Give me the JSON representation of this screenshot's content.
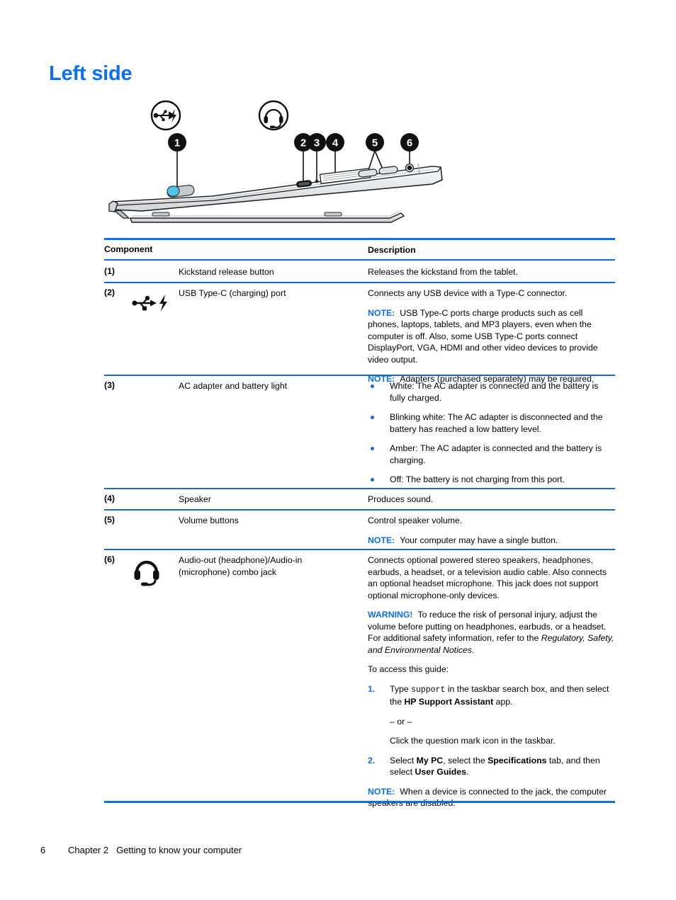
{
  "document": {
    "heading": "Left side",
    "footer": {
      "page_number": "6",
      "chapter": "Chapter 2",
      "chapter_title": "Getting to know your computer"
    },
    "accent_color": "#0a6ff0",
    "rule_color": "#1268d8"
  },
  "figure": {
    "name": "left-side-tablet-illustration",
    "callouts": [
      "1",
      "2",
      "3",
      "4",
      "5",
      "6"
    ],
    "icons": [
      {
        "name": "usb-type-c-charging-icon",
        "label": "USB Type-C charging"
      },
      {
        "name": "headset-icon",
        "label": "Audio-out / Audio-in headset"
      }
    ]
  },
  "table": {
    "headers": {
      "component": "Component",
      "description": "Description"
    },
    "rows": [
      {
        "number": "(1)",
        "icon": "",
        "name": "Kickstand release button",
        "description": "Releases the kickstand from the tablet."
      },
      {
        "number": "(2)",
        "icon": "usb-type-c-charging-icon",
        "name": "USB Type-C (charging) port",
        "desc_intro": "Connects any USB device with a Type-C connector.",
        "note1_label": "NOTE:",
        "note1_text": "USB Type-C ports charge products such as cell phones, laptops, tablets, and MP3 players, even when the computer is off. Also, some USB Type-C ports connect DisplayPort, VGA, HDMI and other video devices to provide video output.",
        "note2_label": "NOTE:",
        "note2_text": "Adapters (purchased separately) may be required."
      },
      {
        "number": "(3)",
        "icon": "",
        "name": "AC adapter and battery light",
        "bullets": [
          "White: The AC adapter is connected and the battery is fully charged.",
          "Blinking white: The AC adapter is disconnected and the battery has reached a low battery level.",
          "Amber: The AC adapter is connected and the battery is charging.",
          "Off: The battery is not charging from this port."
        ]
      },
      {
        "number": "(4)",
        "icon": "",
        "name": "Speaker",
        "description": "Produces sound."
      },
      {
        "number": "(5)",
        "icon": "",
        "name": "Volume buttons",
        "desc_intro": "Control speaker volume.",
        "note1_label": "NOTE:",
        "note1_text": "Your computer may have a single button."
      },
      {
        "number": "(6)",
        "icon": "headset-icon",
        "name": "Audio-out (headphone)/Audio-in (microphone) combo jack",
        "desc_intro": "Connects optional powered stereo speakers, headphones, earbuds, a headset, or a television audio cable. Also connects an optional headset microphone. This jack does not support optional microphone-only devices.",
        "warning_label": "WARNING!",
        "warning_text_a": "To reduce the risk of personal injury, adjust the volume before putting on headphones, earbuds, or a headset. For additional safety information, refer to the ",
        "warning_text_italic": "Regulatory, Safety, and Environmental Notices.",
        "access_intro": "To access this guide:",
        "step1_num": "1.",
        "step1_a": "Type ",
        "step1_mono": "support",
        "step1_b": " in the taskbar search box, and then select the ",
        "step1_bold": "HP Support Assistant",
        "step1_c": " app.",
        "step1_or": "– or –",
        "step1_alt": "Click the question mark icon in the taskbar.",
        "step2_num": "2.",
        "step2_a": "Select ",
        "step2_bold1": "My PC",
        "step2_b": ", select the ",
        "step2_bold2": "Specifications",
        "step2_c": " tab, and then select ",
        "step2_bold3": "User Guides",
        "step2_d": ".",
        "note1_label": "NOTE:",
        "note1_text": "When a device is connected to the jack, the computer speakers are disabled."
      }
    ]
  }
}
